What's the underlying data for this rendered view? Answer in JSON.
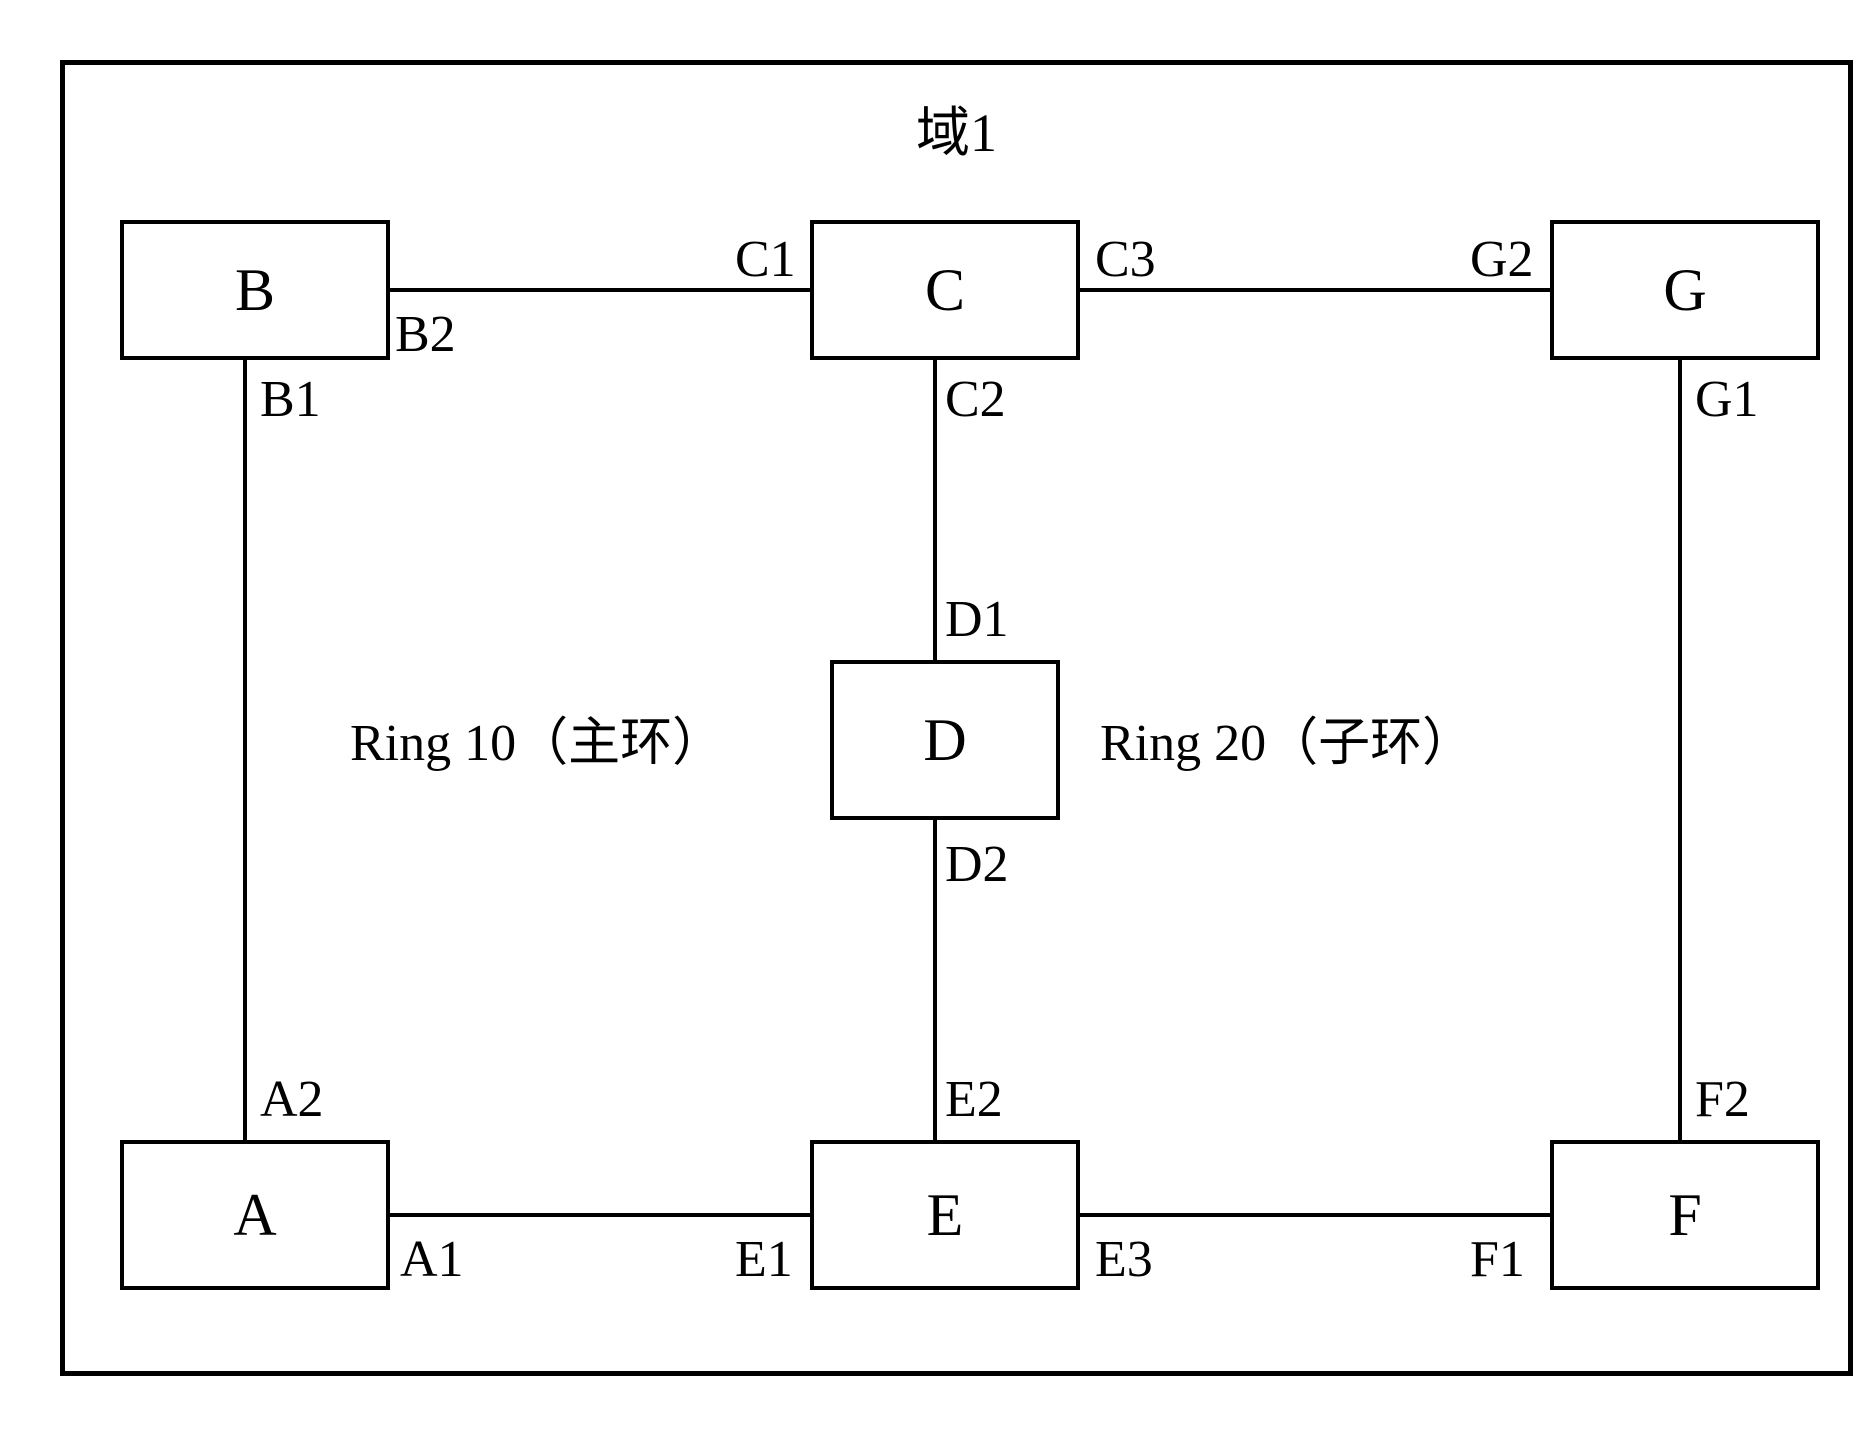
{
  "title": "域1",
  "nodes": {
    "A": "A",
    "B": "B",
    "C": "C",
    "D": "D",
    "E": "E",
    "F": "F",
    "G": "G"
  },
  "portLabels": {
    "A1": "A1",
    "A2": "A2",
    "B1": "B1",
    "B2": "B2",
    "C1": "C1",
    "C2": "C2",
    "C3": "C3",
    "D1": "D1",
    "D2": "D2",
    "E1": "E1",
    "E2": "E2",
    "E3": "E3",
    "F1": "F1",
    "F2": "F2",
    "G1": "G1",
    "G2": "G2"
  },
  "ringLabels": {
    "ring10": "Ring 10（主环）",
    "ring20": "Ring 20（子环）"
  }
}
